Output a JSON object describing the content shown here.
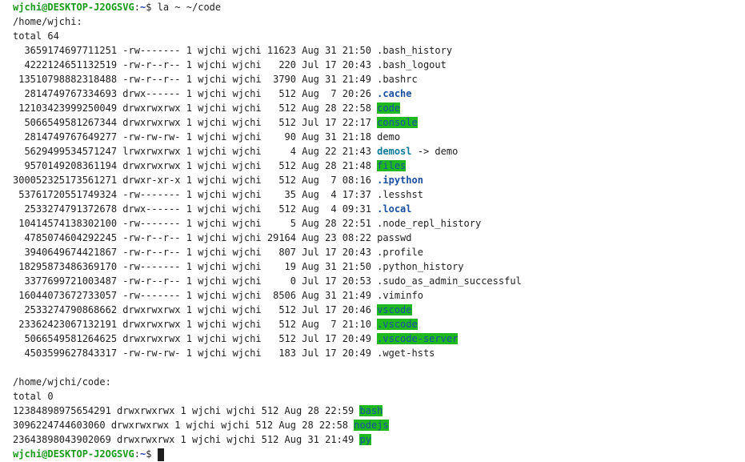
{
  "terminal": {
    "prompt": {
      "user_host": "wjchi@DESKTOP-J2OGSVG",
      "sep": ":",
      "path": "~",
      "suffix": "$ ",
      "command": "la ~ ~/code"
    },
    "home": {
      "header": "/home/wjchi:",
      "total": "total 64",
      "rows": [
        {
          "meta": "  3659174697711251 -rw------- 1 wjchi wjchi 11623 Aug 31 21:50 ",
          "name": ".bash_history",
          "style": "plain"
        },
        {
          "meta": "  4222124651132519 -rw-r--r-- 1 wjchi wjchi   220 Jul 17 20:43 ",
          "name": ".bash_logout",
          "style": "plain"
        },
        {
          "meta": " 13510798882318488 -rw-r--r-- 1 wjchi wjchi  3790 Aug 31 21:49 ",
          "name": ".bashrc",
          "style": "plain"
        },
        {
          "meta": "  2814749767334693 drwx------ 1 wjchi wjchi   512 Aug  7 20:26 ",
          "name": ".cache",
          "style": "blue"
        },
        {
          "meta": " 12103423999250049 drwxrwxrwx 1 wjchi wjchi   512 Aug 28 22:58 ",
          "name": "code",
          "style": "hl"
        },
        {
          "meta": "  5066549581267344 drwxrwxrwx 1 wjchi wjchi   512 Jul 17 22:17 ",
          "name": "console",
          "style": "hl"
        },
        {
          "meta": "  2814749767649277 -rw-rw-rw- 1 wjchi wjchi    90 Aug 31 21:18 ",
          "name": "demo",
          "style": "plain"
        },
        {
          "meta": "  5629499534571247 lrwxrwxrwx 1 wjchi wjchi     4 Aug 22 21:43 ",
          "name": "demosl",
          "style": "cyan",
          "target": " -> demo"
        },
        {
          "meta": "  9570149208361194 drwxrwxrwx 1 wjchi wjchi   512 Aug 28 21:48 ",
          "name": "files",
          "style": "hl"
        },
        {
          "meta": "300052325173561271 drwxr-xr-x 1 wjchi wjchi   512 Aug  7 08:16 ",
          "name": ".ipython",
          "style": "blue"
        },
        {
          "meta": " 53761720551749324 -rw------- 1 wjchi wjchi    35 Aug  4 17:37 ",
          "name": ".lesshst",
          "style": "plain"
        },
        {
          "meta": "  2533274791372678 drwx------ 1 wjchi wjchi   512 Aug  4 09:31 ",
          "name": ".local",
          "style": "blue"
        },
        {
          "meta": " 10414574138302100 -rw------- 1 wjchi wjchi     5 Aug 28 22:51 ",
          "name": ".node_repl_history",
          "style": "plain"
        },
        {
          "meta": "  4785074604292245 -rw-r--r-- 1 wjchi wjchi 29164 Aug 23 08:22 ",
          "name": "passwd",
          "style": "plain"
        },
        {
          "meta": "  3940649674421867 -rw-r--r-- 1 wjchi wjchi   807 Jul 17 20:43 ",
          "name": ".profile",
          "style": "plain"
        },
        {
          "meta": " 18295873486369170 -rw------- 1 wjchi wjchi    19 Aug 31 21:50 ",
          "name": ".python_history",
          "style": "plain"
        },
        {
          "meta": "  3377699721003487 -rw-r--r-- 1 wjchi wjchi     0 Jul 17 20:53 ",
          "name": ".sudo_as_admin_successful",
          "style": "plain"
        },
        {
          "meta": " 16044073672733057 -rw------- 1 wjchi wjchi  8506 Aug 31 21:49 ",
          "name": ".viminfo",
          "style": "plain"
        },
        {
          "meta": "  2533274790868662 drwxrwxrwx 1 wjchi wjchi   512 Jul 17 20:46 ",
          "name": "vscode",
          "style": "hl"
        },
        {
          "meta": " 23362423067132191 drwxrwxrwx 1 wjchi wjchi   512 Aug  7 21:10 ",
          "name": ".vscode",
          "style": "hl"
        },
        {
          "meta": "  5066549581264625 drwxrwxrwx 1 wjchi wjchi   512 Jul 17 20:49 ",
          "name": ".vscode-server",
          "style": "hl"
        },
        {
          "meta": "  4503599627843317 -rw-rw-rw- 1 wjchi wjchi   183 Jul 17 20:49 ",
          "name": ".wget-hsts",
          "style": "plain"
        }
      ]
    },
    "code": {
      "header": "/home/wjchi/code:",
      "total": "total 0",
      "rows": [
        {
          "meta": "12384898975654291 drwxrwxrwx 1 wjchi wjchi 512 Aug 28 22:59 ",
          "name": "bash",
          "style": "hl"
        },
        {
          "meta": "3096224744603060 drwxrwxrwx 1 wjchi wjchi 512 Aug 28 22:58 ",
          "name": "nodejs",
          "style": "hl"
        },
        {
          "meta": "23643898043902069 drwxrwxrwx 1 wjchi wjchi 512 Aug 31 21:49 ",
          "name": "py",
          "style": "hl"
        }
      ]
    },
    "final_prompt": {
      "user_host": "wjchi@DESKTOP-J2OGSVG",
      "sep": ":",
      "path": "~",
      "suffix": "$ "
    }
  }
}
